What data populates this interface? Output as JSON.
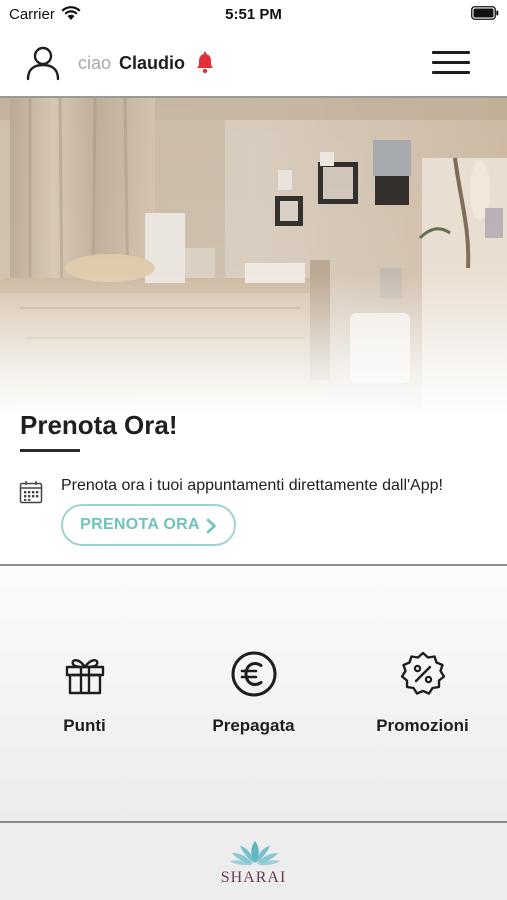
{
  "status_bar": {
    "carrier": "Carrier",
    "time": "5:51 PM"
  },
  "header": {
    "greeting_prefix": "ciao",
    "user_name": "Claudio",
    "bell_color": "#e0303a"
  },
  "booking": {
    "title": "Prenota Ora!",
    "description": "Prenota ora i tuoi appuntamenti direttamente dall'App!",
    "button_label": "PRENOTA ORA",
    "accent_color": "#6ec3bd"
  },
  "features": [
    {
      "label": "Punti",
      "icon": "gift-icon"
    },
    {
      "label": "Prepagata",
      "icon": "euro-icon"
    },
    {
      "label": "Promozioni",
      "icon": "percent-badge-icon"
    }
  ],
  "footer": {
    "brand": "SHARAI",
    "brand_color": "#6b3a56",
    "logo_color": "#5fb8c4"
  }
}
